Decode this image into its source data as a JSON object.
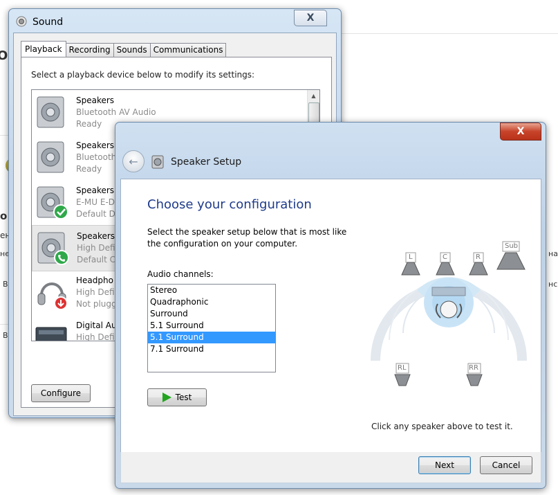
{
  "background": {
    "fragments": [
      "ON",
      "o",
      "ен",
      "не",
      "В",
      "В",
      "на",
      "нс"
    ]
  },
  "sound_window": {
    "title": "Sound",
    "close_glyph": "X",
    "tabs": [
      "Playback",
      "Recording",
      "Sounds",
      "Communications"
    ],
    "prompt": "Select a playback device below to modify its settings:",
    "devices": [
      {
        "name": "Speakers",
        "driver": "Bluetooth AV Audio",
        "status": "Ready",
        "icon": "speaker-icon"
      },
      {
        "name": "Speakers",
        "driver": "Bluetooth",
        "status": "Ready",
        "icon": "speaker-icon"
      },
      {
        "name": "Speakers",
        "driver": "E-MU E-D",
        "status": "Default D",
        "icon": "speaker-default-icon"
      },
      {
        "name": "Speakers",
        "driver": "High Defi",
        "status": "Default C",
        "icon": "speaker-communication-icon"
      },
      {
        "name": "Headpho",
        "driver": "High Defi",
        "status": "Not plugg",
        "icon": "headphones-unplugged-icon"
      },
      {
        "name": "Digital Au",
        "driver": "High Defi",
        "status": "",
        "icon": "digital-audio-icon"
      }
    ],
    "configure_label": "Configure"
  },
  "setup_window": {
    "title": "Speaker Setup",
    "close_glyph": "X",
    "heading": "Choose your configuration",
    "description": "Select the speaker setup below that is most like the configuration on your computer.",
    "channels_label": "Audio channels:",
    "channels": [
      "Stereo",
      "Quadraphonic",
      "Surround",
      "5.1 Surround",
      "5.1 Surround",
      "7.1 Surround"
    ],
    "selected_channel_index": 4,
    "test_label": "Test",
    "speaker_labels": {
      "left": "L",
      "center": "C",
      "right": "R",
      "sub": "Sub",
      "rear_left": "RL",
      "rear_right": "RR"
    },
    "hint": "Click any speaker above to test it.",
    "next_label": "Next",
    "cancel_label": "Cancel"
  },
  "colors": {
    "heading": "#1e3a8a",
    "selection": "#3399ff",
    "play": "#22a51f",
    "close_red": "#c7432a"
  }
}
